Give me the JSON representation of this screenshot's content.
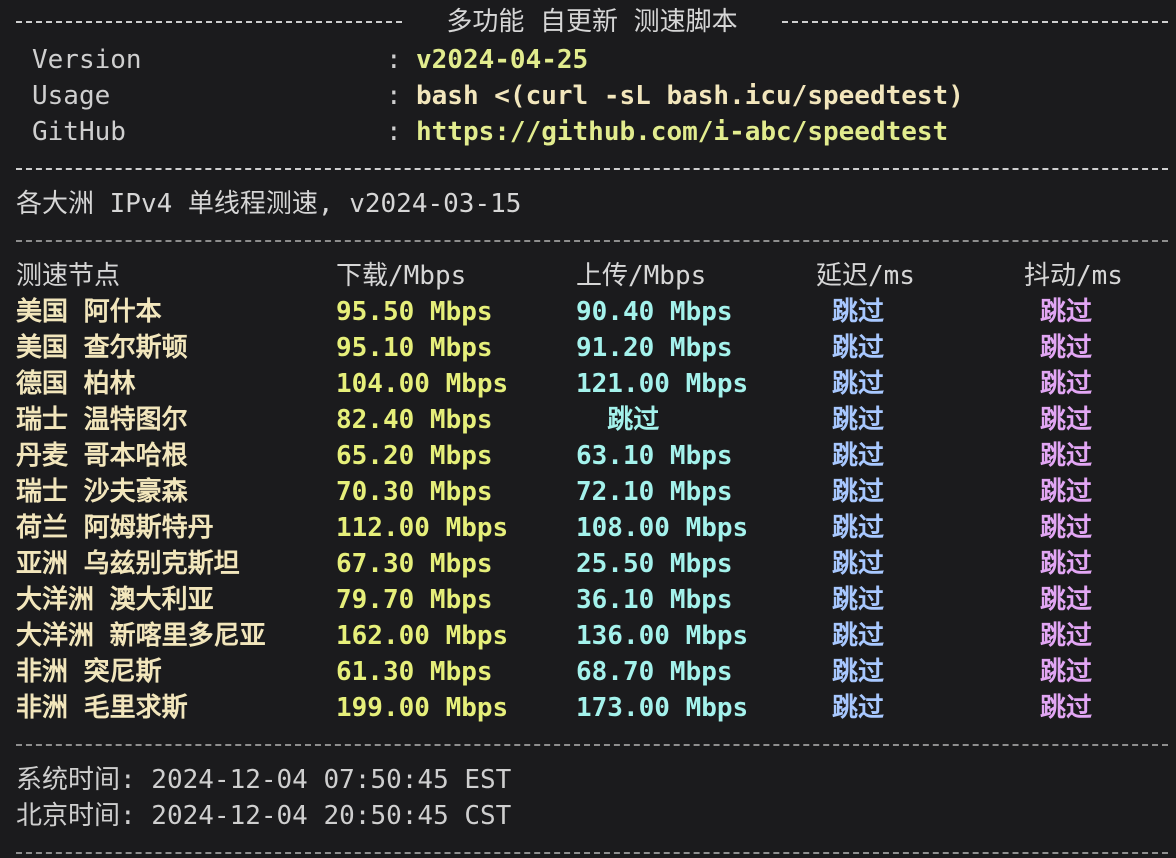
{
  "header": {
    "title": "多功能 自更新 测速脚本",
    "info": [
      {
        "label": "Version",
        "colon": ":",
        "value": "v2024-04-25"
      },
      {
        "label": "Usage",
        "colon": ":",
        "value": "bash <(curl -sL bash.icu/speedtest)"
      },
      {
        "label": "GitHub",
        "colon": ":",
        "value": "https://github.com/i-abc/speedtest"
      }
    ]
  },
  "test": {
    "subtitle": "各大洲 IPv4 单线程测速, v2024-03-15",
    "columns": [
      "测速节点",
      "下载/Mbps",
      "上传/Mbps",
      "延迟/ms",
      "抖动/ms"
    ],
    "rows": [
      {
        "node": "美国 阿什本",
        "down": "95.50 Mbps",
        "up": "90.40 Mbps",
        "latency": "跳过",
        "jitter": "跳过"
      },
      {
        "node": "美国 查尔斯顿",
        "down": "95.10 Mbps",
        "up": "91.20 Mbps",
        "latency": "跳过",
        "jitter": "跳过"
      },
      {
        "node": "德国 柏林",
        "down": "104.00 Mbps",
        "up": "121.00 Mbps",
        "latency": "跳过",
        "jitter": "跳过"
      },
      {
        "node": "瑞士 温特图尔",
        "down": "82.40 Mbps",
        "up": "  跳过",
        "latency": "跳过",
        "jitter": "跳过"
      },
      {
        "node": "丹麦 哥本哈根",
        "down": "65.20 Mbps",
        "up": "63.10 Mbps",
        "latency": "跳过",
        "jitter": "跳过"
      },
      {
        "node": "瑞士 沙夫豪森",
        "down": "70.30 Mbps",
        "up": "72.10 Mbps",
        "latency": "跳过",
        "jitter": "跳过"
      },
      {
        "node": "荷兰 阿姆斯特丹",
        "down": "112.00 Mbps",
        "up": "108.00 Mbps",
        "latency": "跳过",
        "jitter": "跳过"
      },
      {
        "node": "亚洲 乌兹别克斯坦",
        "down": "67.30 Mbps",
        "up": "25.50 Mbps",
        "latency": "跳过",
        "jitter": "跳过"
      },
      {
        "node": "大洋洲 澳大利亚",
        "down": "79.70 Mbps",
        "up": "36.10 Mbps",
        "latency": "跳过",
        "jitter": "跳过"
      },
      {
        "node": "大洋洲 新喀里多尼亚",
        "down": "162.00 Mbps",
        "up": "136.00 Mbps",
        "latency": "跳过",
        "jitter": "跳过"
      },
      {
        "node": "非洲 突尼斯",
        "down": "61.30 Mbps",
        "up": "68.70 Mbps",
        "latency": "跳过",
        "jitter": "跳过"
      },
      {
        "node": "非洲 毛里求斯",
        "down": "199.00 Mbps",
        "up": "173.00 Mbps",
        "latency": "跳过",
        "jitter": "跳过"
      }
    ]
  },
  "footer": {
    "system_time": "系统时间: 2024-12-04 07:50:45 EST",
    "beijing_time": "北京时间: 2024-12-04 20:50:45 CST"
  },
  "colors": {
    "background": "#1b1b1d",
    "node": "#f2e6bc",
    "download": "#e6ef7a",
    "upload": "#a4f2ec",
    "latency": "#a8c8ff",
    "jitter": "#e2a6f4"
  }
}
